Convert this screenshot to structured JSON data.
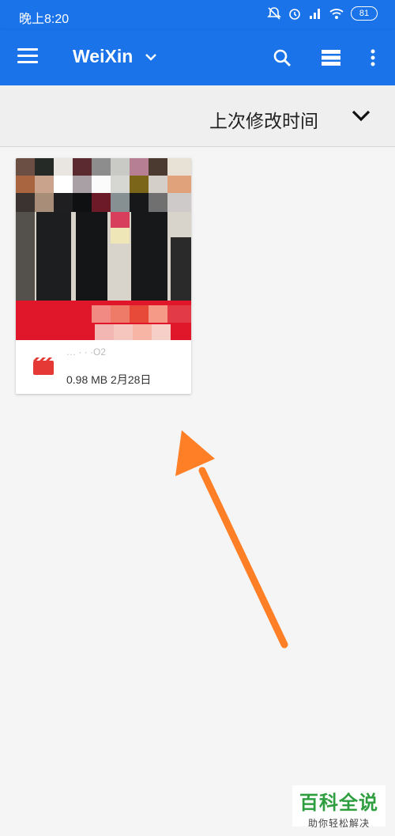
{
  "status_bar": {
    "time": "晚上8:20",
    "battery": "81",
    "icons": [
      "mute-icon",
      "alarm-icon",
      "signal-icon",
      "wifi-icon",
      "battery-icon"
    ]
  },
  "app_bar": {
    "title": "WeiXin",
    "icons": [
      "menu-icon",
      "chevron-down-icon",
      "search-icon",
      "list-view-icon",
      "more-vert-icon"
    ]
  },
  "sort": {
    "label": "上次修改时间"
  },
  "files": [
    {
      "name": "…  ·  · ·O2",
      "size": "0.98 MB",
      "date": "2月28日",
      "meta": "0.98 MB 2月28日",
      "type_icon": "video-file-icon"
    }
  ],
  "colors": {
    "primary": "#1a73e8",
    "arrow": "#ff7f27",
    "watermark": "#2e9e3f"
  },
  "watermark": {
    "title": "百科全说",
    "subtitle": "助你轻松解决"
  }
}
